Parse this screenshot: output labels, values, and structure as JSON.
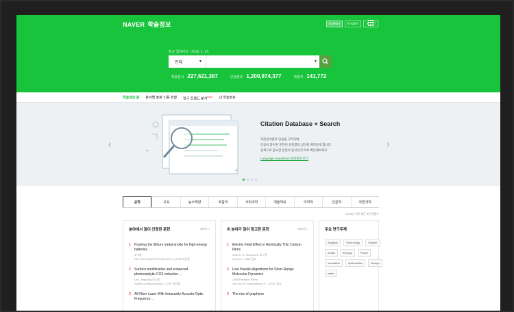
{
  "header": {
    "brand": "NAVER",
    "service": "학술정보",
    "lang_korean": "Korean",
    "lang_english": "English",
    "login": "로그인",
    "update": "최근 업데이트 : 2019. 1. 23.",
    "search_scope": "전체",
    "search_placeholder": "",
    "stats": [
      {
        "label": "학술문서",
        "value": "227,621,367"
      },
      {
        "label": "인용정보",
        "value": "1,200,974,377"
      },
      {
        "label": "학술지",
        "value": "141,772"
      }
    ]
  },
  "nav": {
    "items": [
      {
        "label": "학술정보 홈"
      },
      {
        "label": "분야별 출판·인용 현황"
      },
      {
        "label": "연구 트렌드 분석",
        "badge": "Beta"
      },
      {
        "label": "내 학술정보"
      }
    ]
  },
  "banner": {
    "title": "Citation Database + Search",
    "lines": [
      "학문분야별로 인용을 고려하여,",
      "인용이 많이된 문헌이 검색결과 상단에 배치되게 합니다.",
      "검색으로 중요한 문헌의 중요인지 바로 확인해보세요."
    ],
    "link": "Language acquisition 검색결과 보기"
  },
  "categories": [
    "공학",
    "교육",
    "농수해양",
    "복합학",
    "사회과학",
    "예술체육",
    "의약학",
    "인문학",
    "자연과학"
  ],
  "sort_note": "2019년 기준   최근 5년 인용수",
  "cards": {
    "most_cited": {
      "title": "분야에서 많이 인용된 문헌",
      "more": "더보기 >",
      "articles": [
        {
          "num": "1",
          "title": "Pushing the lithium metal anode for high-energy batteries",
          "authors": "외 5명",
          "meta": "NATURE NANOTECHNOLOGY  |  2258 피인용"
        },
        {
          "num": "2",
          "title": "Surface modification and enhanced photocatalytic CO2 reduction ...",
          "authors": "Lee, Jingdong 외 2명",
          "meta": "Applied surface science  |  1763 피인용"
        },
        {
          "num": "3",
          "title": "All-Fiber Laser With Intracavity Acousto-Optic Frequency ...",
          "authors": "",
          "meta": ""
        }
      ]
    },
    "most_referenced": {
      "title": "이 분야가 많이 참고한 문헌",
      "more": "더보기 >",
      "articles": [
        {
          "num": "1",
          "title": "Electric Field Effect in Atomically Thin Carbon Films",
          "authors": "2004  K. S. Novoselov 외 7명",
          "meta": "Science  |  4960 참고"
        },
        {
          "num": "2",
          "title": "Fast Parallel Algorithms for Short-Range Molecular Dynamics",
          "authors": "1995  Plimpton Steve",
          "meta": "Journal of Computational P...  |  4253 참고"
        },
        {
          "num": "3",
          "title": "The rise of graphene",
          "authors": "",
          "meta": ""
        }
      ]
    },
    "keywords": {
      "title": "주요 연구주제",
      "items": [
        "Analysis",
        "Technology",
        "System",
        "model",
        "Energy",
        "Power",
        "simulation",
        "optimization",
        "Design",
        "water"
      ]
    }
  },
  "colors": {
    "brand_green": "#19c43d",
    "search_button": "#56a13e",
    "number_red": "#e0512f"
  }
}
